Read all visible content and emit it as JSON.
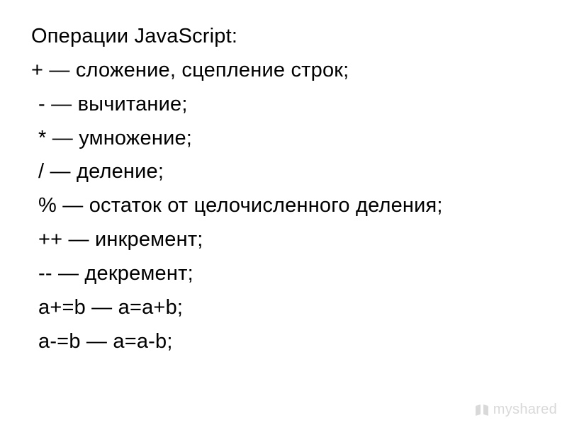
{
  "slide": {
    "title": "Операции JavaScript:",
    "lines": [
      "+ — сложение, сцепление строк;",
      "- — вычитание;",
      "* — умножение;",
      "/ — деление;",
      "% — остаток от целочисленного деления;",
      "++ — инкремент;",
      "-- — декремент;",
      "a+=b — a=a+b;",
      "a-=b — a=a-b;"
    ]
  },
  "watermark": {
    "text": "myshared"
  }
}
